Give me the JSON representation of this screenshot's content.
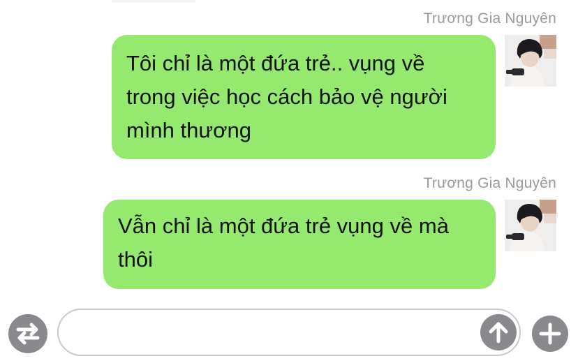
{
  "messages": [
    {
      "sender": "Trương Gia Nguyên",
      "lines": [
        "Tôi chỉ là một đứa trẻ.. vụng về",
        "trong việc học cách bảo vệ người",
        "mình thương"
      ]
    },
    {
      "sender": "Trương Gia Nguyên",
      "lines": [
        "Vẫn chỉ là một đứa trẻ vụng về mà",
        "thôi"
      ]
    }
  ],
  "composer": {
    "input_value": "",
    "switch_icon": "swap-arrows-icon",
    "send_icon": "arrow-up-icon",
    "add_icon": "plus-icon"
  },
  "colors": {
    "bubble": "#95e96e",
    "sender_name": "#9a9a9a",
    "icon_button": "#8a8a8e"
  }
}
